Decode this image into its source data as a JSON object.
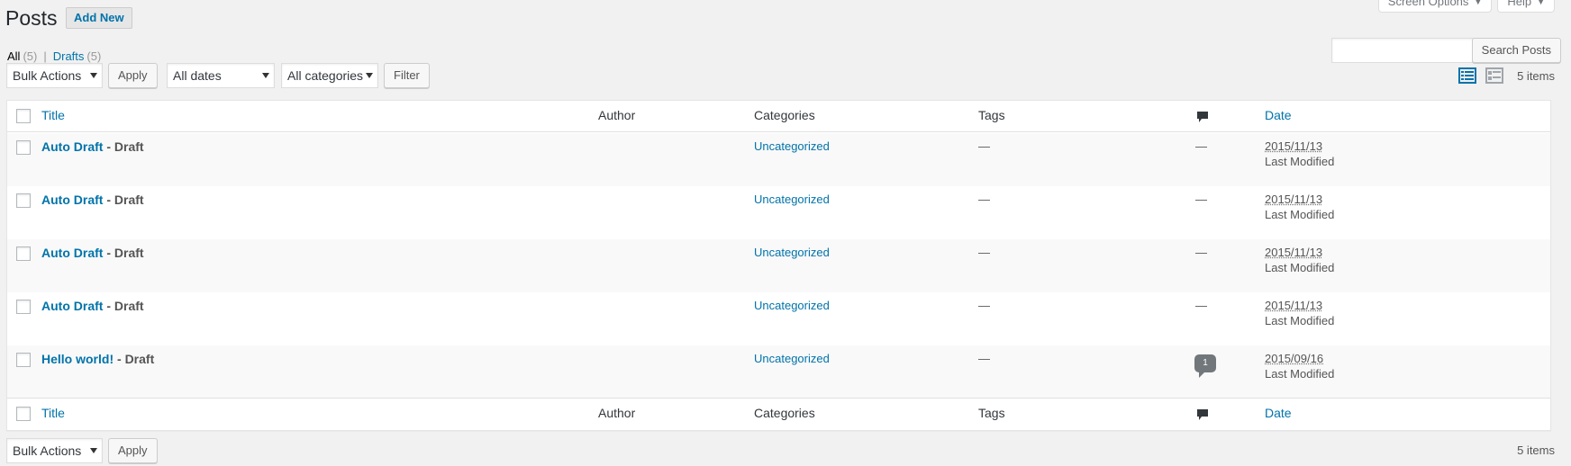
{
  "header": {
    "title": "Posts",
    "add_new": "Add New",
    "screen_options": "Screen Options",
    "help": "Help"
  },
  "views": {
    "all_label": "All",
    "all_count": "(5)",
    "separator": "|",
    "drafts_label": "Drafts",
    "drafts_count": "(5)"
  },
  "search": {
    "placeholder": "",
    "button": "Search Posts"
  },
  "tablenav_top": {
    "bulk_actions": "Bulk Actions",
    "apply": "Apply",
    "dates": "All dates",
    "categories": "All categories",
    "filter": "Filter",
    "items": "5 items"
  },
  "tablenav_bottom": {
    "bulk_actions": "Bulk Actions",
    "apply": "Apply",
    "items": "5 items"
  },
  "columns": {
    "title": "Title",
    "author": "Author",
    "categories": "Categories",
    "tags": "Tags",
    "comments_icon": "comment-icon",
    "date": "Date"
  },
  "rows": [
    {
      "title": "Auto Draft",
      "state": " - Draft",
      "category": "Uncategorized",
      "tags": "—",
      "comments": "—",
      "date": "2015/11/13",
      "date_status": "Last Modified"
    },
    {
      "title": "Auto Draft",
      "state": " - Draft",
      "category": "Uncategorized",
      "tags": "—",
      "comments": "—",
      "date": "2015/11/13",
      "date_status": "Last Modified"
    },
    {
      "title": "Auto Draft",
      "state": " - Draft",
      "category": "Uncategorized",
      "tags": "—",
      "comments": "—",
      "date": "2015/11/13",
      "date_status": "Last Modified"
    },
    {
      "title": "Auto Draft",
      "state": " - Draft",
      "category": "Uncategorized",
      "tags": "—",
      "comments": "—",
      "date": "2015/11/13",
      "date_status": "Last Modified"
    },
    {
      "title": "Hello world!",
      "state": " - Draft",
      "category": "Uncategorized",
      "tags": "—",
      "comments": "1",
      "date": "2015/09/16",
      "date_status": "Last Modified"
    }
  ],
  "colors": {
    "link": "#0073aa",
    "background": "#f1f1f1",
    "view_icon_active": "#0073aa",
    "view_icon_inactive": "#a0a5aa",
    "comment_bubble": "#72777c"
  },
  "icons": {
    "list_view": "list-view-icon",
    "excerpt_view": "excerpt-view-icon"
  }
}
